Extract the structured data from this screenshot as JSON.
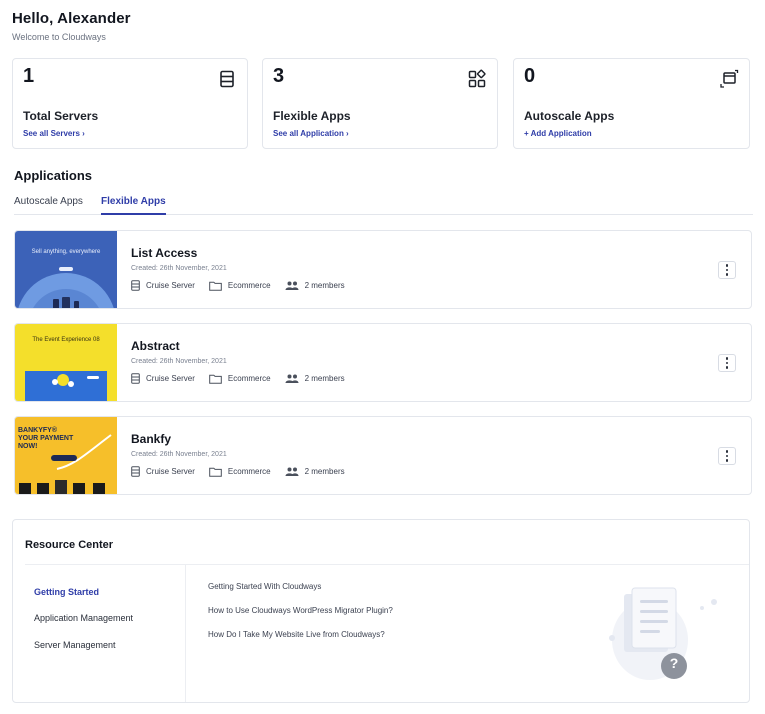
{
  "greeting": {
    "title": "Hello, Alexander",
    "subtitle": "Welcome to Cloudways"
  },
  "stats": [
    {
      "count": "1",
      "title": "Total Servers",
      "link": "See all Servers ›",
      "icon": "server-icon"
    },
    {
      "count": "3",
      "title": "Flexible Apps",
      "link": "See all Application ›",
      "icon": "apps-grid-icon"
    },
    {
      "count": "0",
      "title": "Autoscale Apps",
      "link": "+ Add Application",
      "icon": "autoscale-window-icon"
    }
  ],
  "applications": {
    "title": "Applications",
    "tabs": [
      {
        "label": "Autoscale Apps",
        "active": false
      },
      {
        "label": "Flexible Apps",
        "active": true
      }
    ],
    "items": [
      {
        "name": "List Access",
        "created": "Created: 26th November, 2021",
        "server": "Cruise Server",
        "project": "Ecommerce",
        "members": "2 members",
        "thumb_text": "Sell anything, everywhere"
      },
      {
        "name": "Abstract",
        "created": "Created: 26th November, 2021",
        "server": "Cruise Server",
        "project": "Ecommerce",
        "members": "2 members",
        "thumb_text": "The Event Experience 08"
      },
      {
        "name": "Bankfy",
        "created": "Created: 26th November, 2021",
        "server": "Cruise Server",
        "project": "Ecommerce",
        "members": "2 members",
        "thumb_text": "BANKYFY® YOUR PAYMENT NOW!"
      }
    ]
  },
  "resource_center": {
    "title": "Resource Center",
    "nav": [
      {
        "label": "Getting Started",
        "active": true
      },
      {
        "label": "Application Management",
        "active": false
      },
      {
        "label": "Server Management",
        "active": false
      }
    ],
    "links": [
      "Getting Started With Cloudways",
      "How to Use Cloudways WordPress Migrator Plugin?",
      "How Do I Take My Website Live from Cloudways?"
    ],
    "help_glyph": "?"
  },
  "colors": {
    "accent": "#2f3da8",
    "border": "#e3e6ec",
    "text": "#12161f"
  }
}
